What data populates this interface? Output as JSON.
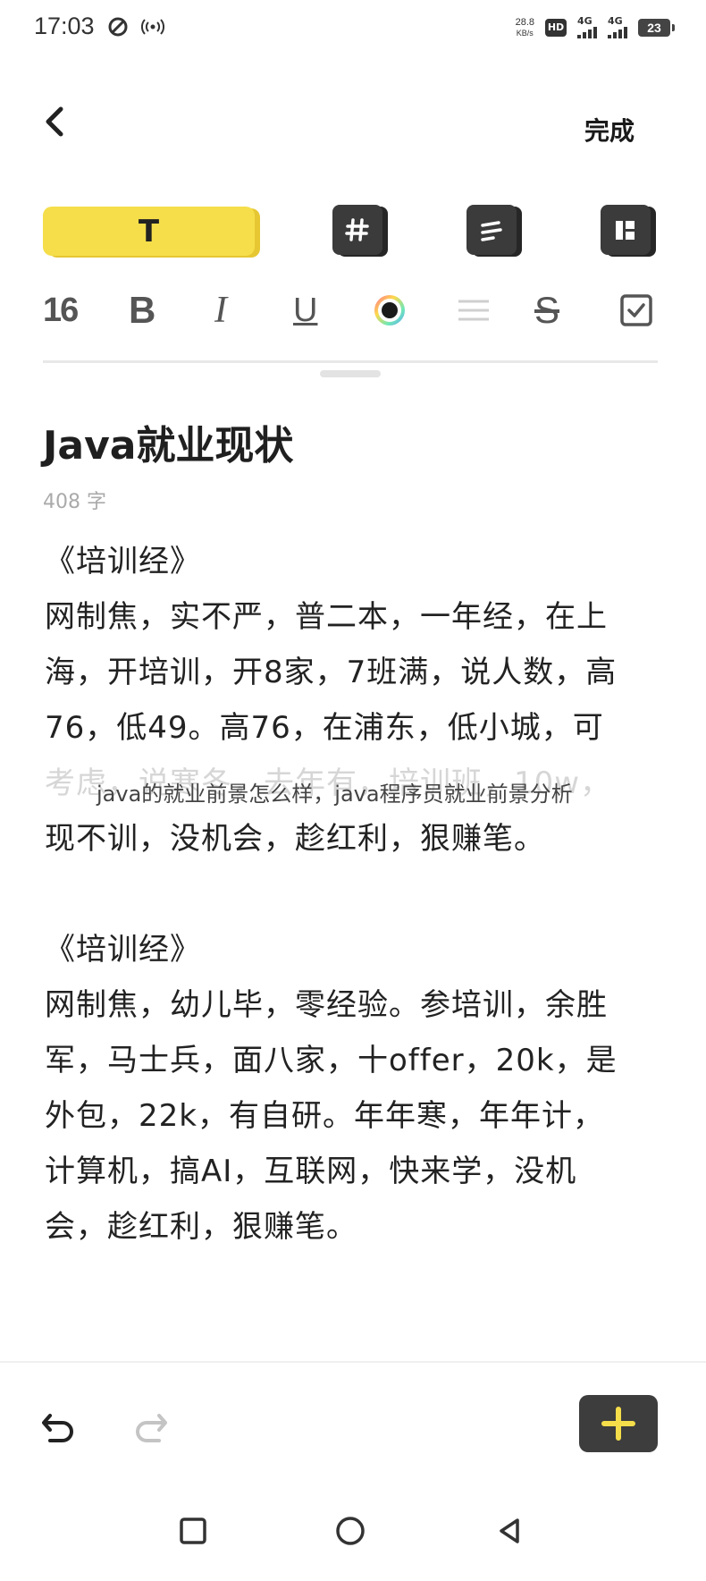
{
  "status_bar": {
    "time": "17:03",
    "speed_value": "28.8",
    "speed_unit": "KB/s",
    "hd": "HD",
    "sim1": "4G",
    "sim2": "4G",
    "battery": "23"
  },
  "header": {
    "done_label": "完成"
  },
  "style_buttons": {
    "text_label": "T",
    "icons": [
      "heading-icon",
      "list-icon",
      "layout-icon"
    ]
  },
  "format_toolbar": {
    "font_size": "16",
    "bold": "B",
    "italic": "I",
    "underline": "U",
    "strikethrough": "S",
    "accent_color": "#f5de4a"
  },
  "note": {
    "title": "Java就业现状",
    "word_count": "408 字",
    "paragraph1": [
      "《培训经》",
      "网制焦，实不严，普二本，一年经，在上",
      "海，开培训，开8家，7班满，说人数，高",
      "76，低49。高76，在浦东，低小城，可",
      "考虑，说寒冬，去年有，培训班，10w，",
      "现不训，没机会，趁红利，狠赚笔。"
    ],
    "paragraph2": [
      "《培训经》",
      "网制焦，幼儿毕，零经验。参培训，余胜",
      "军，马士兵，面八家，十offer，20k，是",
      "外包，22k，有自研。年年寒，年年计，",
      "计算机，搞AI，互联网，快来学，没机",
      "会，趁红利，狠赚笔。"
    ]
  },
  "watermark": "java的就业前景怎么样，java程序员就业前景分析"
}
